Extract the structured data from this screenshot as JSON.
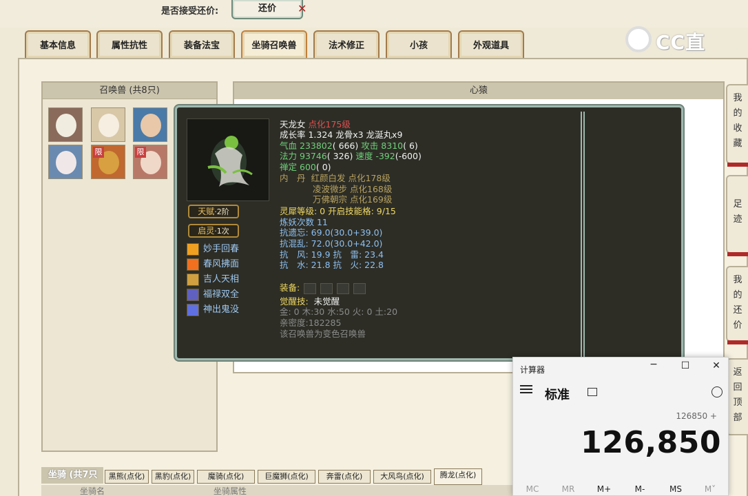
{
  "top": {
    "bargain_label": "是否接受还价:",
    "bargain_button": "还价"
  },
  "logo": {
    "text": "CC直播"
  },
  "tabs": [
    {
      "label": "基本信息"
    },
    {
      "label": "属性抗性"
    },
    {
      "label": "装备法宝"
    },
    {
      "label": "坐骑召唤兽"
    },
    {
      "label": "法术修正"
    },
    {
      "label": "小孩"
    },
    {
      "label": "外观道具"
    }
  ],
  "summon_panel": {
    "title": "召唤兽 (共8只)",
    "limit_badge": "限"
  },
  "heart_panel": {
    "title": "心猿"
  },
  "side_tabs": [
    {
      "label": "我的收藏"
    },
    {
      "label": "足迹"
    },
    {
      "label": "我的还价"
    },
    {
      "label": "返回顶部"
    }
  ],
  "tooltip": {
    "name": "天龙女",
    "level": "点化175级",
    "growth": "成长率 1.324 龙骨x3 龙涎丸x9",
    "hp_label": "气血",
    "hp": "233802",
    "hp_extra": "( 666)",
    "atk_label": "攻击",
    "atk": "8310",
    "atk_extra": "( 6)",
    "mp_label": "法力",
    "mp": "93746",
    "mp_extra": "( 326)",
    "spd_label": "速度",
    "spd": "-392",
    "spd_extra": "(-600)",
    "zen_label": "禅定",
    "zen": "600",
    "zen_extra": "( 0)",
    "neidan_label": "内　丹",
    "neidan": [
      {
        "name": "红颜白发",
        "level": "点化178级"
      },
      {
        "name": "凌波微步",
        "level": "点化168级"
      },
      {
        "name": "万佛朝宗",
        "level": "点化169级"
      }
    ],
    "lingxi": "灵犀等级: 0 开启技能格: 9/15",
    "lianyao": "炼妖次数 11",
    "res1": "抗遗忘: 69.0(30.0+39.0)",
    "res2": "抗混乱: 72.0(30.0+42.0)",
    "res3": "抗　风: 19.9 抗　雷: 23.4",
    "res4": "抗　水: 21.8 抗　火: 22.8",
    "equip_label": "装备:",
    "awaken_label": "觉醒技:",
    "awaken_value": "未觉醒",
    "elements": "金: 0 木:30 水:50 火: 0 土:20",
    "intimacy": "亲密度:182285",
    "note": "该召唤兽为变色召唤兽",
    "talent": "天赋",
    "talent_level": "2阶",
    "qiling": "启灵",
    "qiling_count": "1次",
    "skills": [
      {
        "name": "妙手回春",
        "color": "#f0a020"
      },
      {
        "name": "春风拂面",
        "color": "#f07020"
      },
      {
        "name": "吉人天相",
        "color": "#d0a040"
      },
      {
        "name": "福禄双全",
        "color": "#6060c0"
      },
      {
        "name": "神出鬼没",
        "color": "#6070e0"
      }
    ]
  },
  "mount": {
    "title": "坐骑 (共7只",
    "tabs": [
      {
        "label": "黑熊(点化)"
      },
      {
        "label": "黑豹(点化)"
      },
      {
        "label": "魔骑(点化)"
      },
      {
        "label": "巨魔狮(点化)"
      },
      {
        "label": "奔雷(点化)"
      },
      {
        "label": "大风鸟(点化)"
      },
      {
        "label": "腾龙(点化)"
      }
    ],
    "col1": "坐骑名",
    "col2": "坐骑属性"
  },
  "calculator": {
    "title": "计算器",
    "mode": "标准",
    "expression": "126850 +",
    "display": "126,850",
    "memory": [
      "MC",
      "MR",
      "M+",
      "M-",
      "MS",
      "M˅"
    ]
  }
}
